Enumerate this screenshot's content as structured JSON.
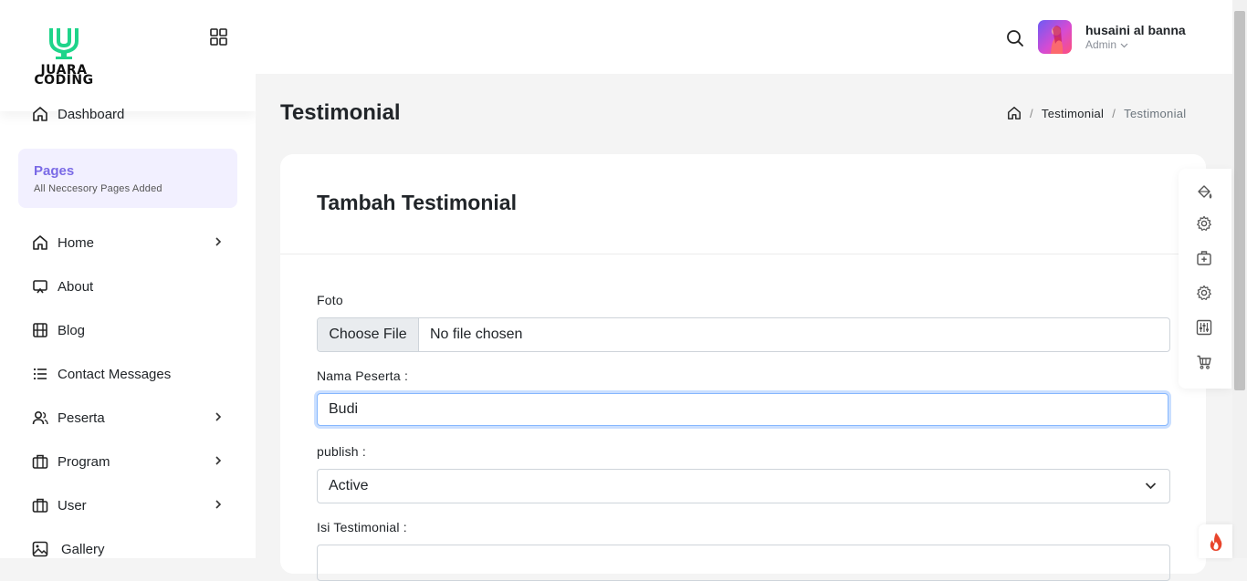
{
  "brand": {
    "logo_line1": "JUARA",
    "logo_line2": "CODING"
  },
  "sidebar": {
    "dashboard_label": "Dashboard",
    "pages_title": "Pages",
    "pages_subtitle": "All Neccesory Pages Added",
    "items": [
      {
        "label": "Home",
        "icon": "home-icon",
        "has_submenu": true
      },
      {
        "label": "About",
        "icon": "screen-icon",
        "has_submenu": false
      },
      {
        "label": "Blog",
        "icon": "film-icon",
        "has_submenu": false
      },
      {
        "label": "Contact Messages",
        "icon": "list-icon",
        "has_submenu": false
      },
      {
        "label": "Peserta",
        "icon": "users-icon",
        "has_submenu": true
      },
      {
        "label": "Program",
        "icon": "briefcase-icon",
        "has_submenu": true
      },
      {
        "label": "User",
        "icon": "briefcase-icon",
        "has_submenu": true
      },
      {
        "label": "Gallery",
        "icon": "image-icon",
        "has_submenu": false
      }
    ]
  },
  "header": {
    "user_name": "husaini al banna",
    "user_role": "Admin"
  },
  "page": {
    "title": "Testimonial",
    "breadcrumb": [
      "Testimonial",
      "Testimonial"
    ]
  },
  "form": {
    "card_title": "Tambah Testimonial",
    "foto_label": "Foto",
    "file_button": "Choose File",
    "file_status": "No file chosen",
    "nama_label": "Nama Peserta :",
    "nama_value": "Budi",
    "publish_label": "publish :",
    "publish_value": "Active",
    "isi_label": "Isi Testimonial :"
  },
  "colors": {
    "accent": "#7a6ae6",
    "pages_bg": "#f2f0ff",
    "logo_green": "#1ed48a",
    "focus_border": "#86b7fe",
    "fire": "#e8452c"
  }
}
